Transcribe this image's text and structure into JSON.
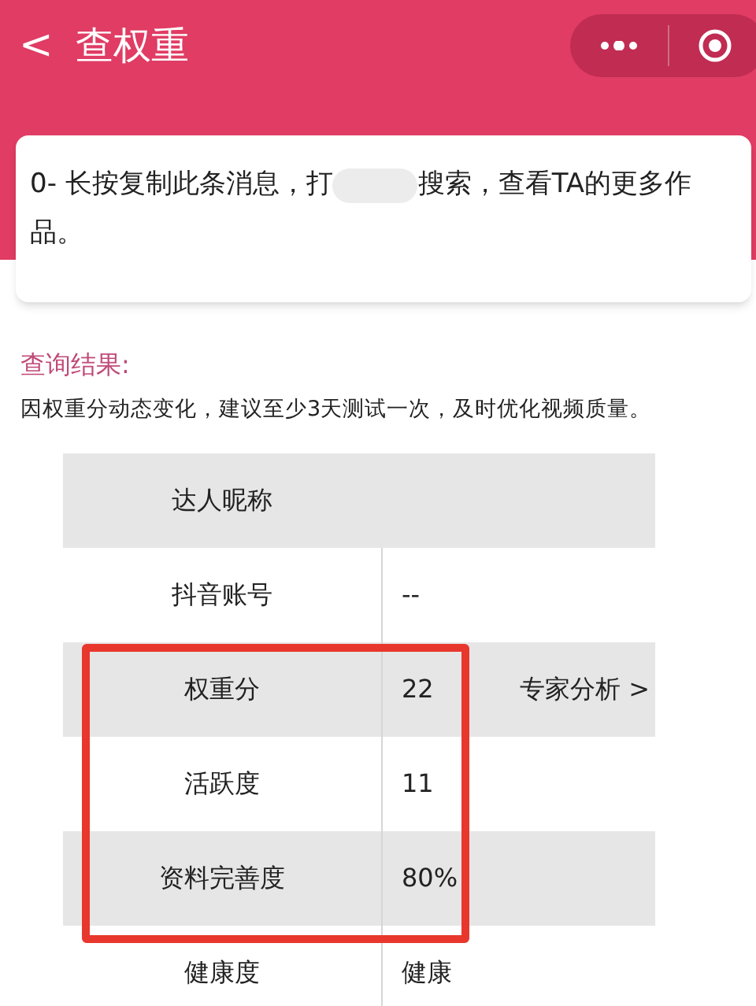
{
  "header": {
    "back": "<",
    "title": "查权重"
  },
  "message": {
    "before": "0- 长按复制此条消息，打",
    "after": "搜索，查看TA的更多作",
    "continued": "品。"
  },
  "result": {
    "heading": "查询结果:",
    "notice": "因权重分动态变化，建议至少3天测试一次，及时优化视频质量。"
  },
  "table": {
    "rows": [
      {
        "label": "达人昵称"
      },
      {
        "label": "抖音账号",
        "value": "--"
      },
      {
        "label": "权重分",
        "value": "22",
        "action": "专家分析 >"
      },
      {
        "label": "活跃度",
        "value": "11"
      },
      {
        "label": "资料完善度",
        "value": "80%"
      },
      {
        "label": "健康度",
        "value": "健康"
      }
    ]
  }
}
